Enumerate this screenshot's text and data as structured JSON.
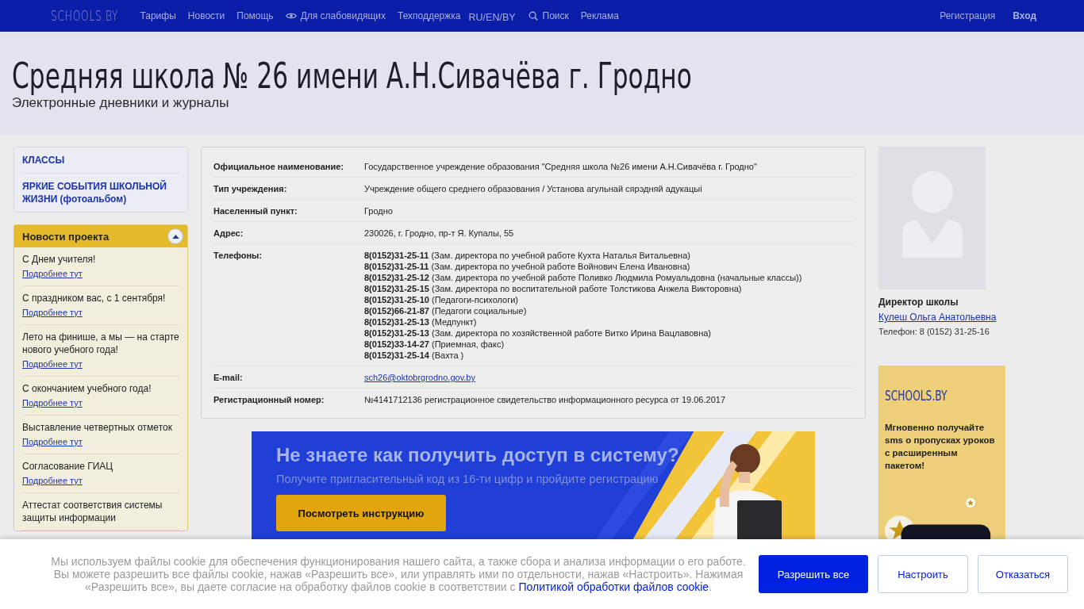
{
  "header": {
    "logo": "SCHOOLS.BY",
    "nav": [
      {
        "label": "Тарифы",
        "kind": "link"
      },
      {
        "label": "Новости",
        "kind": "link"
      },
      {
        "label": "Помощь",
        "kind": "link"
      },
      {
        "label": "Для слабовидящих",
        "kind": "eye"
      },
      {
        "label": "Техподдержка",
        "kind": "link"
      },
      {
        "label": "RU/EN/BY",
        "kind": "lang"
      },
      {
        "label": "Поиск",
        "kind": "search"
      },
      {
        "label": "Реклама",
        "kind": "link"
      }
    ],
    "account": [
      {
        "label": "Регистрация",
        "kind": "link"
      },
      {
        "label": "Вход",
        "kind": "strong"
      }
    ]
  },
  "school": {
    "title": "Средняя школа № 26 имени А.Н.Сивачёва г. Гродно",
    "subtitle": "Электронные дневники и журналы"
  },
  "sidebar": {
    "menu": [
      "КЛАССЫ",
      "ЯРКИЕ СОБЫТИЯ ШКОЛЬНОЙ ЖИЗНИ (фотоальбом)"
    ],
    "news": {
      "title": "Новости проекта",
      "expanded": true,
      "items": [
        {
          "title": "С Днем учителя!",
          "link": "Подробнее тут"
        },
        {
          "title": "С праздником вас, с 1 сентября!",
          "link": "Подробнее тут"
        },
        {
          "title": "Лето на финише, а мы — на старте нового учебного года!",
          "link": "Подробнее тут"
        },
        {
          "title": "С окончанием учебного года!",
          "link": "Подробнее тут"
        },
        {
          "title": "Выставление четвертных отметок",
          "link": "Подробнее тут"
        },
        {
          "title": "Согласование ГИАЦ",
          "link": "Подробнее тут"
        },
        {
          "title": "Аттестат соответствия системы защиты информации"
        }
      ]
    }
  },
  "info": [
    {
      "label": "Официальное наименование:",
      "kind": "text",
      "value": "Государственное учреждение образования \"Средняя школа №26 имени А.Н.Сивачёва г. Гродно\""
    },
    {
      "label": "Тип учреждения:",
      "kind": "text",
      "value": "Учреждение общего среднего образования / Установа агульнай сярэдняй адукацыі"
    },
    {
      "label": "Населенный пункт:",
      "kind": "text",
      "value": "Гродно"
    },
    {
      "label": "Адрес:",
      "kind": "text",
      "value": "230026, г. Гродно, пр-т Я. Купалы, 55"
    },
    {
      "label": "Телефоны:",
      "kind": "phones",
      "phones": [
        {
          "number": "8(0152)31-25-11",
          "note": "(Зам. директора по учебной работе Кухта Наталья Витальевна)"
        },
        {
          "number": "8(0152)31-25-11",
          "note": "(Зам. директора по учебной работе Войнович Елена Ивановна)"
        },
        {
          "number": "8(0152)31-25-12",
          "note": "(Зам. директора по учебной работе Поливко Людмила Ромуальдовна (начальные классы))"
        },
        {
          "number": "8(0152)31-25-15",
          "note": "(Зам. директора по воспитательной работе Толстикова Анжела Викторовна)"
        },
        {
          "number": "8(0152)31-25-10",
          "note": "(Педагоги-психологи)"
        },
        {
          "number": "8(0152)66-21-87",
          "note": "(Педагоги социальные)"
        },
        {
          "number": "8(0152)31-25-13",
          "note": "(Медпункт)"
        },
        {
          "number": "8(0152)31-25-13",
          "note": "(Зам. директора по хозяйственной работе Витко Ирина Вацлавовна)"
        },
        {
          "number": "8(0152)33-14-27",
          "note": "(Приемная, факс)"
        },
        {
          "number": "8(0152)31-25-14",
          "note": "(Вахта )"
        }
      ]
    },
    {
      "label": "E-mail:",
      "kind": "link",
      "value": "sch26@oktobrgrodno.gov.by"
    },
    {
      "label": "Регистрационный номер:",
      "kind": "text",
      "value": "№4141712136 регистрационное свидетельство информационного ресурса от 19.06.2017"
    }
  ],
  "banner": {
    "heading": "Не знаете как получить доступ в систему?",
    "subheading": "Получите пригласительный код из 16-ти цифр и пройдите регистрацию",
    "button": "Посмотреть инструкцию"
  },
  "director": {
    "caption": "Директор школы",
    "name": "Кулеш Ольга Анатольевна",
    "phone": "Телефон: 8 (0152) 31-25-16"
  },
  "ad": {
    "logo": "SCHOOLS.BY",
    "text": "Мгновенно получайте sms о пропусках уроков с расширенным пакетом!"
  },
  "cookie": {
    "text": "Мы используем файлы cookie для обеспечения функционирования нашего сайта, а также сбора и анализа информации о его работе. Вы можете разрешить все файлы cookie, нажав «Разрешить все», или управлять ими по отдельности, нажав «Настроить». Нажимая «Разрешить все», вы даете согласие на обработку файлов cookie в соответствии с",
    "link": "Политикой обработки файлов cookie",
    "tail": ".",
    "buttons": [
      {
        "label": "Разрешить все",
        "kind": "primary"
      },
      {
        "label": "Настроить",
        "kind": "outline"
      },
      {
        "label": "Отказаться",
        "kind": "outline"
      }
    ]
  }
}
